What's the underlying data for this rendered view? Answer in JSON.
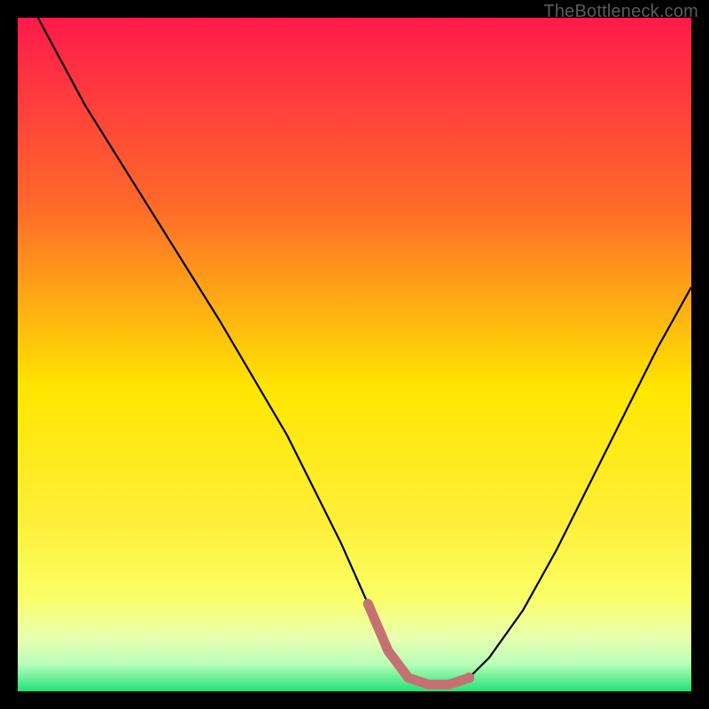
{
  "watermark": "TheBottleneck.com",
  "colors": {
    "curve_stroke": "#000000",
    "highlight_stroke": "#c67171",
    "black_border": "#000000",
    "grad_top": "#ff1a4b",
    "grad_mid1": "#ff8a1f",
    "grad_mid2": "#ffe600",
    "grad_low1": "#faff66",
    "grad_low2": "#e8ffb0",
    "grad_low3": "#b8ffb8",
    "grad_bottom": "#22e07a"
  },
  "chart_data": {
    "type": "line",
    "title": "",
    "xlabel": "",
    "ylabel": "",
    "xlim": [
      0,
      100
    ],
    "ylim": [
      0,
      100
    ],
    "series": [
      {
        "name": "bottleneck-curve",
        "x": [
          3,
          10,
          20,
          30,
          40,
          48,
          52,
          55,
          58,
          61,
          64,
          67,
          70,
          75,
          80,
          85,
          90,
          95,
          100
        ],
        "values": [
          100,
          87,
          71,
          55,
          38,
          22,
          13,
          6,
          2,
          1,
          1,
          2,
          5,
          12,
          21,
          31,
          41,
          51,
          60
        ]
      }
    ],
    "highlight_range_x": [
      52,
      69
    ],
    "highlight_note": "pink/salmon segment near curve minimum"
  }
}
